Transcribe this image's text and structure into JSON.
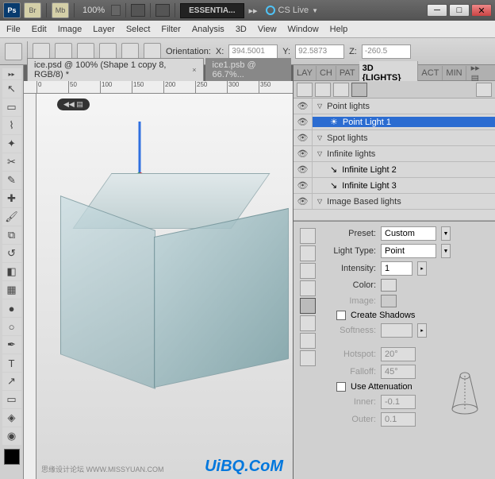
{
  "titlebar": {
    "ps": "Ps",
    "br": "Br",
    "mb": "Mb",
    "zoom": "100%",
    "workspace": "ESSENTIA...",
    "cslive": "CS Live"
  },
  "menu": [
    "File",
    "Edit",
    "Image",
    "Layer",
    "Select",
    "Filter",
    "Analysis",
    "3D",
    "View",
    "Window",
    "Help"
  ],
  "optbar": {
    "orientation": "Orientation:",
    "x_lbl": "X:",
    "x": "394.5001",
    "y_lbl": "Y:",
    "y": "92.5873",
    "z_lbl": "Z:",
    "z": "-260.5"
  },
  "tabs": {
    "active": "ice.psd @ 100% (Shape 1 copy 8, RGB/8) *",
    "inactive": "ice1.psb @ 66.7%..."
  },
  "ruler_ticks": [
    "0",
    "50",
    "100",
    "150",
    "200",
    "250",
    "300",
    "350"
  ],
  "panel_tabs": [
    "LAY",
    "CH",
    "PAT",
    "3D {LIGHTS}",
    "ACT",
    "MIN"
  ],
  "lights": {
    "point_hdr": "Point lights",
    "point_light_1": "Point Light 1",
    "spot_hdr": "Spot lights",
    "infinite_hdr": "Infinite lights",
    "infinite_2": "Infinite Light 2",
    "infinite_3": "Infinite Light 3",
    "image_hdr": "Image Based lights"
  },
  "props": {
    "preset_lbl": "Preset:",
    "preset_val": "Custom",
    "type_lbl": "Light Type:",
    "type_val": "Point",
    "intensity_lbl": "Intensity:",
    "intensity_val": "1",
    "color_lbl": "Color:",
    "image_lbl": "Image:",
    "shadows_lbl": "Create Shadows",
    "softness_lbl": "Softness:",
    "hotspot_lbl": "Hotspot:",
    "hotspot_val": "20°",
    "falloff_lbl": "Falloff:",
    "falloff_val": "45°",
    "atten_lbl": "Use Attenuation",
    "inner_lbl": "Inner:",
    "inner_val": "-0.1",
    "outer_lbl": "Outer:",
    "outer_val": "0.1"
  },
  "watermark": "UiBQ.CoM",
  "watermark2": "思缘设计论坛  WWW.MISSYUAN.COM"
}
